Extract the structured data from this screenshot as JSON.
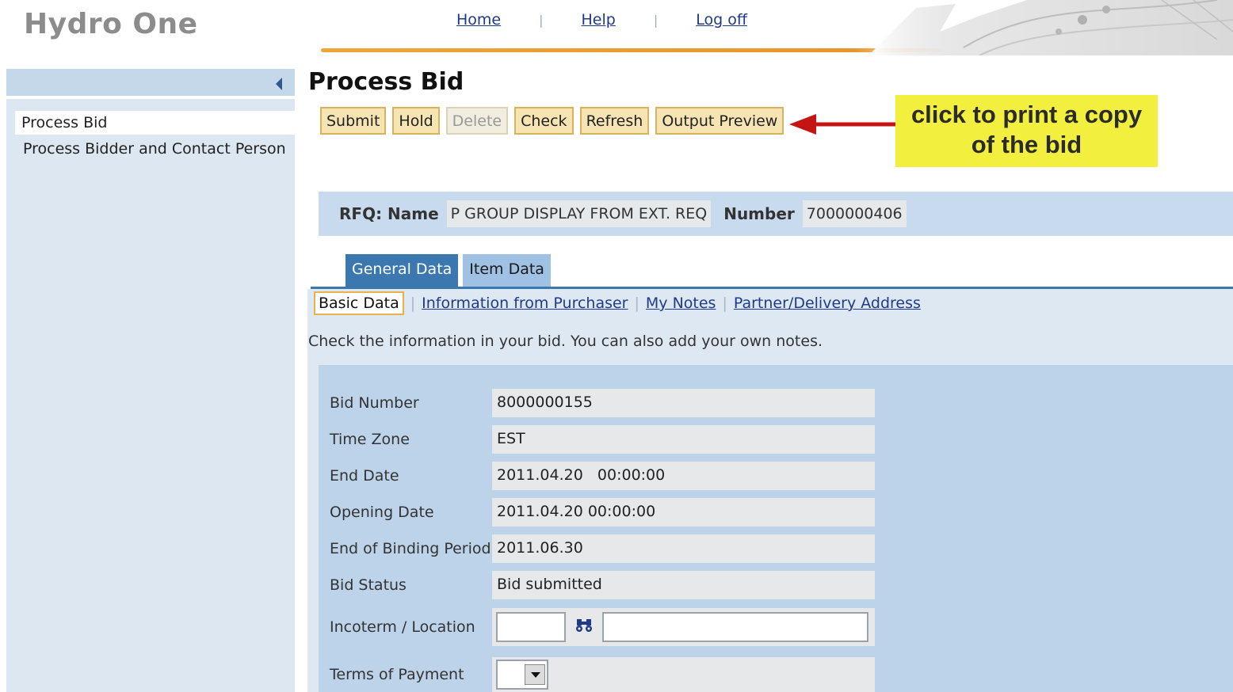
{
  "header": {
    "logo": "Hydro One",
    "links": {
      "home": "Home",
      "help": "Help",
      "logoff": "Log off"
    },
    "separator": "|",
    "accent_color": "#e8952a"
  },
  "sidebar": {
    "items": [
      {
        "label": "Process Bid",
        "active": true
      },
      {
        "label": "Process Bidder and Contact Person",
        "active": false
      }
    ]
  },
  "page": {
    "title": "Process Bid",
    "toolbar": {
      "submit": "Submit",
      "hold": "Hold",
      "delete": "Delete",
      "check": "Check",
      "refresh": "Refresh",
      "output_preview": "Output Preview"
    },
    "callout": {
      "line1": "click to print a copy",
      "line2": "of the bid"
    }
  },
  "rfq": {
    "name_label": "RFQ: Name",
    "name_value": "P GROUP DISPLAY FROM EXT. REQ",
    "number_label": "Number",
    "number_value": "7000000406"
  },
  "tabs": [
    {
      "label": "General Data",
      "active": true
    },
    {
      "label": "Item Data",
      "active": false
    }
  ],
  "subtabs": {
    "basic": "Basic Data",
    "purchaser": "Information from Purchaser",
    "notes": "My Notes",
    "partner": "Partner/Delivery Address"
  },
  "hint": "Check the information in your bid. You can also add your own notes.",
  "form": {
    "bid_number": {
      "label": "Bid Number",
      "value": "8000000155"
    },
    "time_zone": {
      "label": "Time Zone",
      "value": "EST"
    },
    "end_date": {
      "label": "End Date",
      "value": "2011.04.20   00:00:00"
    },
    "opening_date": {
      "label": "Opening Date",
      "value": "2011.04.20 00:00:00"
    },
    "binding_period": {
      "label": "End of Binding Period",
      "value": "2011.06.30"
    },
    "bid_status": {
      "label": "Bid Status",
      "value": "Bid submitted"
    },
    "incoterm": {
      "label": "Incoterm / Location",
      "code": "",
      "location": ""
    },
    "terms_payment": {
      "label": "Terms of Payment",
      "value": ""
    }
  },
  "icons": {
    "collapse": "collapse-left-icon",
    "search": "binoculars-icon",
    "dropdown": "chevron-down-icon",
    "arrow": "red-arrow-icon"
  }
}
